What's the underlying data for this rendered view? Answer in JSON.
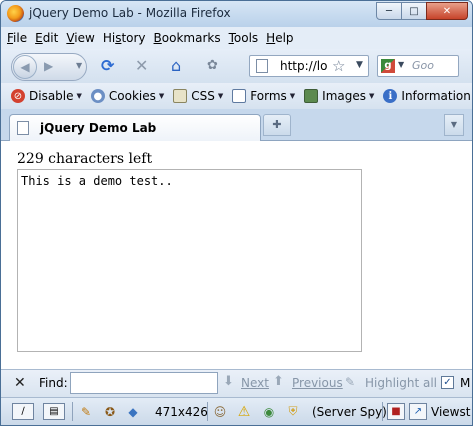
{
  "window": {
    "title": "jQuery Demo Lab - Mozilla Firefox"
  },
  "menubar": {
    "items": [
      {
        "label": "File",
        "key": "F",
        "rest": "ile"
      },
      {
        "label": "Edit",
        "key": "E",
        "rest": "dit"
      },
      {
        "label": "View",
        "key": "V",
        "rest": "iew"
      },
      {
        "label": "History",
        "key": "s",
        "pre": "Hi",
        "rest": "tory"
      },
      {
        "label": "Bookmarks",
        "key": "B",
        "rest": "ookmarks"
      },
      {
        "label": "Tools",
        "key": "T",
        "rest": "ools"
      },
      {
        "label": "Help",
        "key": "H",
        "rest": "elp"
      }
    ]
  },
  "navbar": {
    "url": "http://lo",
    "search_placeholder": "Goo"
  },
  "devbar": {
    "items": [
      "Disable",
      "Cookies",
      "CSS",
      "Forms",
      "Images",
      "Information"
    ]
  },
  "tabs": [
    {
      "label": "jQuery Demo Lab"
    }
  ],
  "content": {
    "counter": "229 characters left",
    "textarea_value": "This is a demo test.."
  },
  "findbar": {
    "label": "Find:",
    "value": "",
    "next": "Next",
    "previous": "Previous",
    "highlight_all": "Highlight all",
    "match_case_truncated": "M"
  },
  "statusbar": {
    "dimensions": "471x426",
    "server_spy": "(Server Spy)",
    "viewsize": "Viewst"
  }
}
